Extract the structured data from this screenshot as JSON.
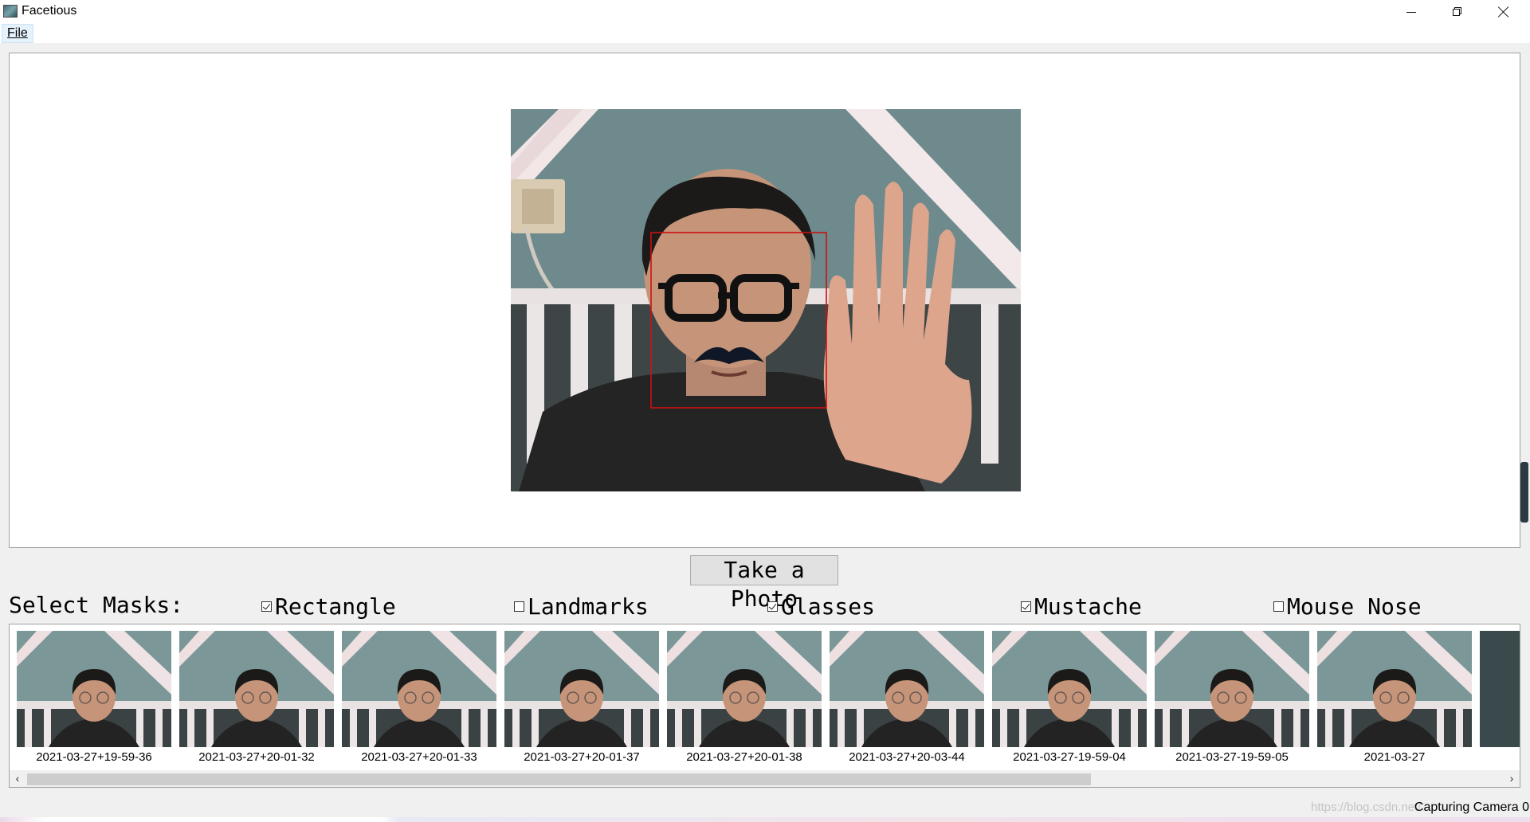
{
  "window": {
    "title": "Facetious",
    "icon": "app-icon",
    "controls": [
      "minimize-icon",
      "restore-icon",
      "close-icon"
    ]
  },
  "menu": {
    "file_label": "File"
  },
  "main": {
    "take_photo_label": "Take a Photo",
    "select_masks_label": "Select Masks:",
    "masks": [
      {
        "label": "Rectangle",
        "checked": true
      },
      {
        "label": "Landmarks",
        "checked": false
      },
      {
        "label": "Glasses",
        "checked": true
      },
      {
        "label": "Mustache",
        "checked": true
      },
      {
        "label": "Mouse Nose",
        "checked": false
      }
    ]
  },
  "gallery": {
    "items": [
      {
        "label": "2021-03-27+19-59-36"
      },
      {
        "label": "2021-03-27+20-01-32"
      },
      {
        "label": "2021-03-27+20-01-33"
      },
      {
        "label": "2021-03-27+20-01-37"
      },
      {
        "label": "2021-03-27+20-01-38"
      },
      {
        "label": "2021-03-27+20-03-44"
      },
      {
        "label": "2021-03-27-19-59-04"
      },
      {
        "label": "2021-03-27-19-59-05"
      },
      {
        "label": "2021-03-27"
      }
    ]
  },
  "status": {
    "text": "Capturing Camera 0",
    "watermark": "https://blog.csdn.net/..."
  },
  "colors": {
    "face_rect": "#cc1111",
    "window_bg": "#f0f0f0",
    "menu_highlight": "#e5f1fb"
  }
}
